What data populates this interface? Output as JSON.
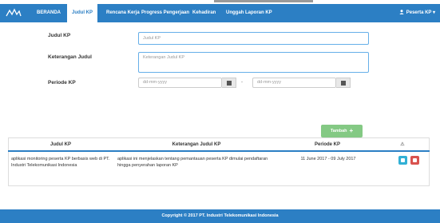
{
  "nav": {
    "logo_icon": "app-logo-icon",
    "items": [
      {
        "label": "BERANDA",
        "active": false
      },
      {
        "label": "Judul KP",
        "active": true
      },
      {
        "label": "Rencana Kerja",
        "active": false
      },
      {
        "label": "Progress Pengerjaan",
        "active": false
      },
      {
        "label": "Kehadiran",
        "active": false
      },
      {
        "label": "Unggah Laporan KP",
        "active": false
      }
    ],
    "user_label": "Peserta KP",
    "user_icon": "user-icon"
  },
  "form": {
    "judul_label": "Judul KP",
    "judul_placeholder": "Judul KP",
    "keterangan_label": "Keterangan Judul",
    "keterangan_placeholder": "Keterangan Judul KP",
    "periode_label": "Periode KP",
    "date_start_placeholder": "dd-mm-yyyy",
    "date_end_placeholder": "dd-mm-yyyy",
    "date_separator": "-",
    "calendar_icon": "calendar-icon",
    "submit_label": "Tambah",
    "submit_icon": "plus-icon"
  },
  "table": {
    "headers": [
      "Judul KP",
      "Keterangan Judul KP",
      "Periode KP"
    ],
    "action_header_icon": "sort-icon",
    "rows": [
      {
        "judul": "aplikasi monitoring peserta KP berbasis web di PT. Industri Telekomunikasi Indonesia",
        "keterangan": "aplikasi ini menjelaskan tentang pemantauan peserta KP dimulai pendaftaran hingga penyerahan laporan KP",
        "periode": "11 June 2017 - 09 July 2017",
        "edit_icon": "edit-icon",
        "delete_icon": "trash-icon"
      }
    ]
  },
  "footer": {
    "text": "Copyright © 2017 PT. Industri Telekomunikasi Indonesia"
  },
  "colors": {
    "primary": "#2c7fc4",
    "success": "#5cb85c",
    "info": "#31b0d5",
    "danger": "#d9534f"
  }
}
